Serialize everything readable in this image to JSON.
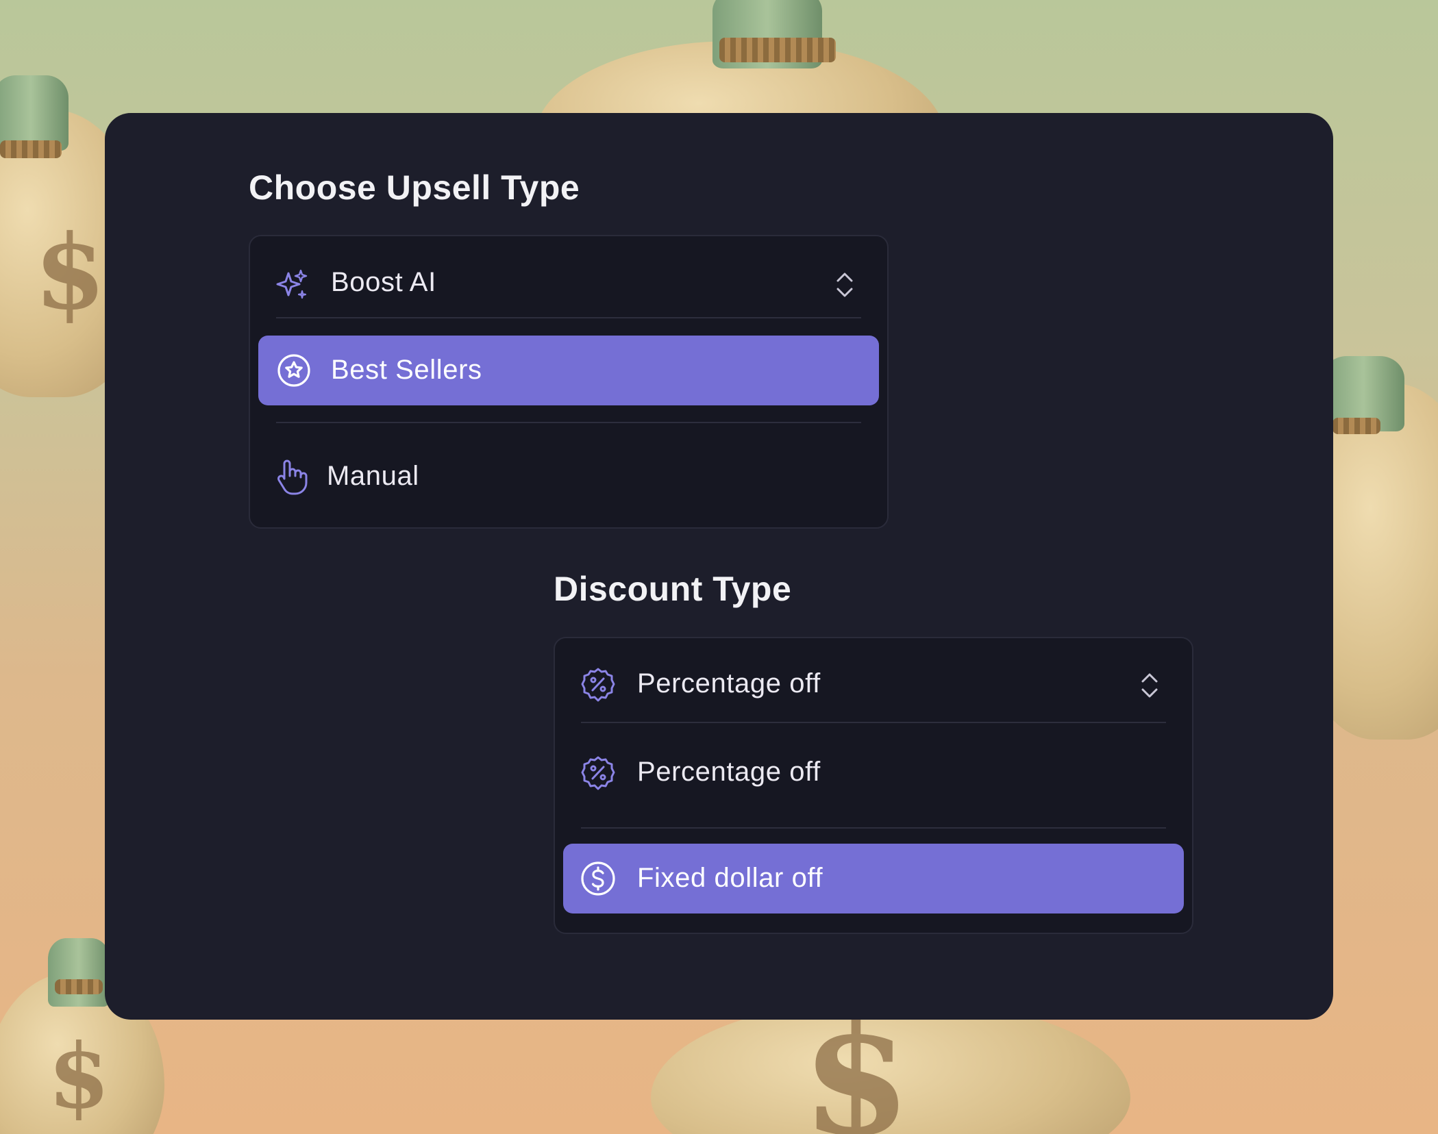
{
  "upsell": {
    "title": "Choose Upsell Type",
    "options": [
      {
        "label": "Boost AI",
        "icon": "sparkles-icon",
        "selected": false
      },
      {
        "label": "Best Sellers",
        "icon": "star-circle-icon",
        "selected": true
      },
      {
        "label": "Manual",
        "icon": "pointer-hand-icon",
        "selected": false
      }
    ]
  },
  "discount": {
    "title": "Discount Type",
    "options": [
      {
        "label": "Percentage off",
        "icon": "percent-badge-icon",
        "selected": false
      },
      {
        "label": "Percentage off",
        "icon": "percent-badge-icon",
        "selected": false
      },
      {
        "label": "Fixed dollar off",
        "icon": "dollar-circle-icon",
        "selected": true
      }
    ]
  },
  "colors": {
    "accent": "#756fd5",
    "card": "#1d1e2b",
    "panel": "#161722",
    "icon": "#8b84e6"
  }
}
